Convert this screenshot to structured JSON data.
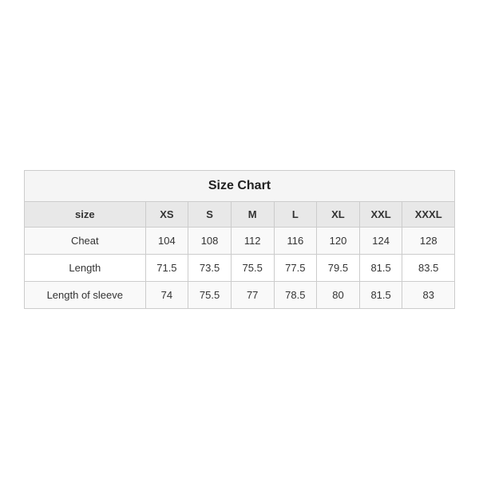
{
  "chart": {
    "title": "Size Chart",
    "headers": [
      "size",
      "XS",
      "S",
      "M",
      "L",
      "XL",
      "XXL",
      "XXXL"
    ],
    "rows": [
      {
        "label": "Cheat",
        "values": [
          "104",
          "108",
          "112",
          "116",
          "120",
          "124",
          "128"
        ]
      },
      {
        "label": "Length",
        "values": [
          "71.5",
          "73.5",
          "75.5",
          "77.5",
          "79.5",
          "81.5",
          "83.5"
        ]
      },
      {
        "label": "Length of sleeve",
        "values": [
          "74",
          "75.5",
          "77",
          "78.5",
          "80",
          "81.5",
          "83"
        ]
      }
    ]
  }
}
